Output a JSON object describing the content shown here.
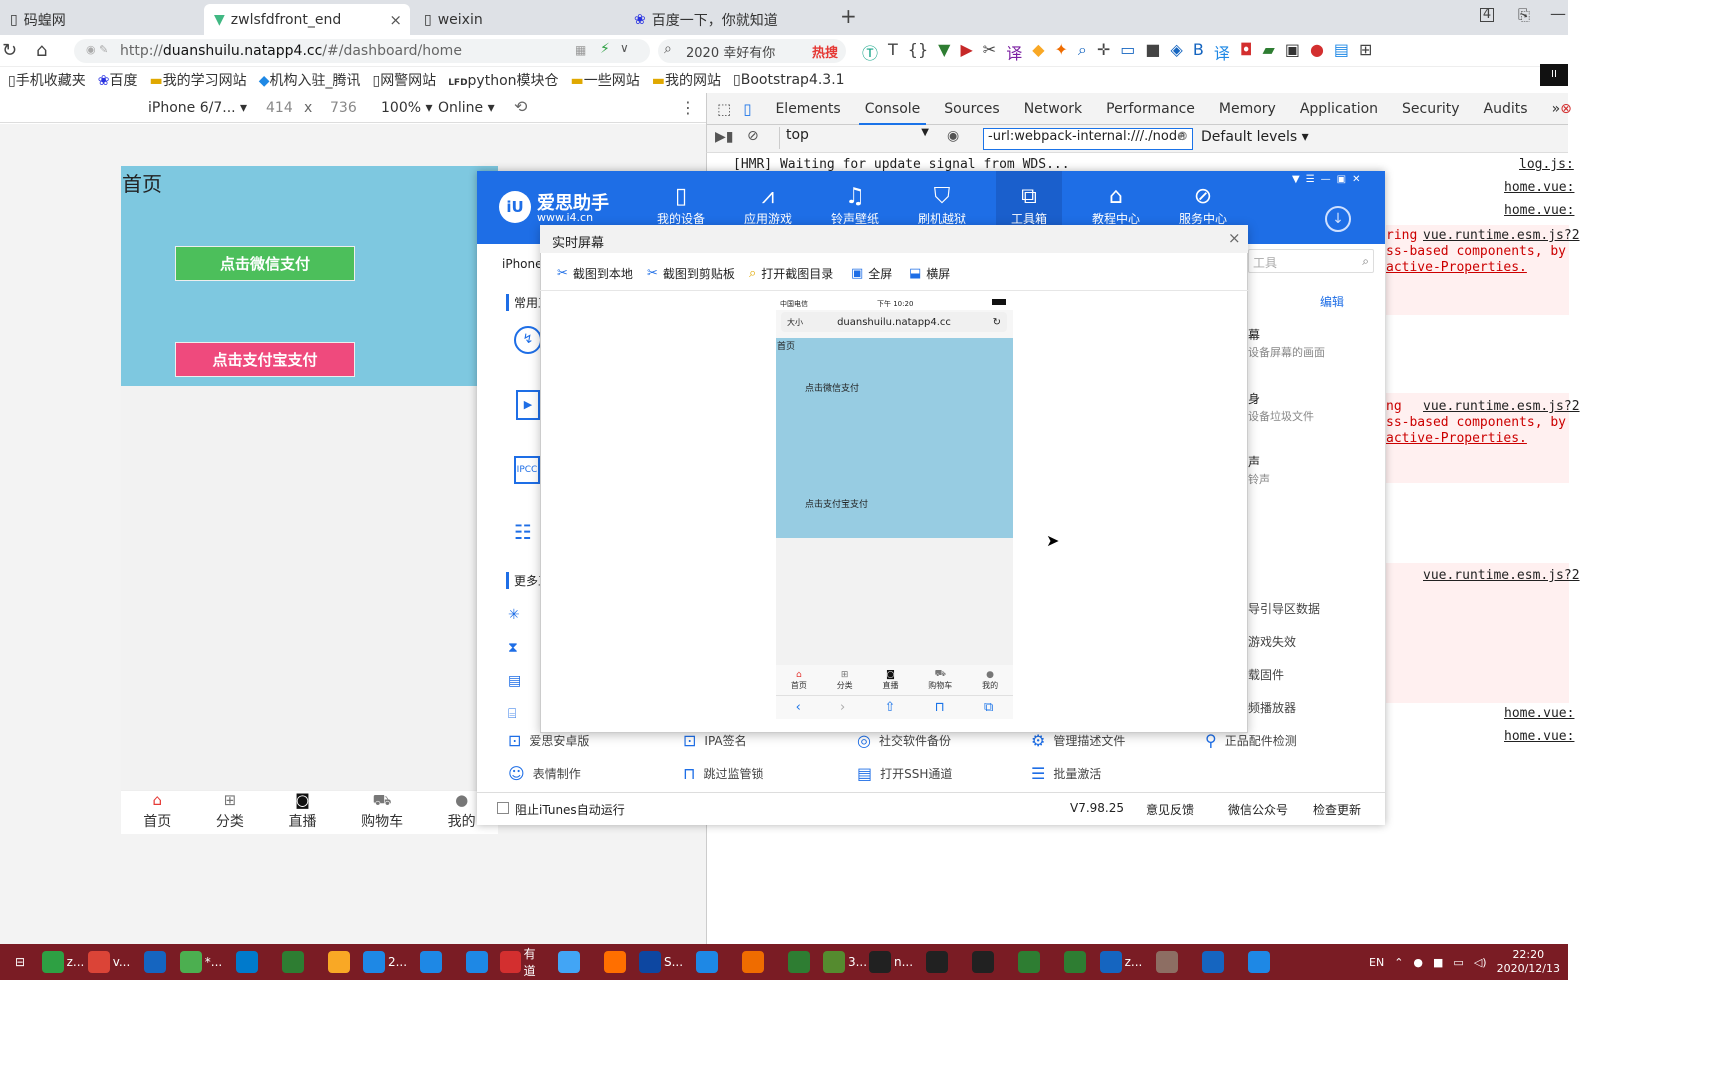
{
  "tabs": [
    {
      "label": "码蝗网"
    },
    {
      "label": "zwlsfdfront_end"
    },
    {
      "label": "weixin"
    },
    {
      "label": "百度一下，你就知道"
    }
  ],
  "addressbar": {
    "url_prefix": "http://",
    "url_domain": "duanshuilu.natapp4.cc",
    "url_path": "/#/dashboard/home",
    "search_text": "2020 幸好有你",
    "hot_label": "热搜"
  },
  "bookmarks": [
    "手机收藏夹",
    "百度",
    "我的学习网站",
    "机构入驻_腾讯",
    "网警网站",
    "python模块仓",
    "一些网站",
    "我的网站",
    "Bootstrap4.3.1"
  ],
  "device_toolbar": {
    "device": "iPhone 6/7...",
    "width": "414",
    "x": "x",
    "height": "736",
    "zoom": "100%",
    "network": "Online"
  },
  "phone": {
    "title": "首页",
    "wechat_pay": "点击微信支付",
    "alipay": "点击支付宝支付",
    "nav": [
      {
        "label": "首页",
        "icon": "home-icon"
      },
      {
        "label": "分类",
        "icon": "grid-icon"
      },
      {
        "label": "直播",
        "icon": "tv-icon"
      },
      {
        "label": "购物车",
        "icon": "cart-icon"
      },
      {
        "label": "我的",
        "icon": "user-icon"
      }
    ]
  },
  "devtools": {
    "tabs": [
      "Elements",
      "Console",
      "Sources",
      "Network",
      "Performance",
      "Memory",
      "Application",
      "Security",
      "Audits"
    ],
    "more": "»",
    "context": "top",
    "filter": "-url:webpack-internal:///./node",
    "levels": "Default levels"
  },
  "console": {
    "hmr": "[HMR] Waiting for update signal from WDS...",
    "links": [
      "log.js:",
      "home.vue:",
      "home.vue:",
      "vue.runtime.esm.js?2",
      "vue.runtime.esm.js?2",
      "vue.runtime.esm.js?2",
      "home.vue:",
      "home.vue:"
    ],
    "warn1": [
      "ring",
      "ss-based components, by",
      "active-Properties."
    ],
    "warn2": [
      "ng",
      "ss-based components, by",
      "active-Properties."
    ]
  },
  "i4": {
    "brand": "爱思助手",
    "site": "www.i4.cn",
    "nav": [
      "我的设备",
      "应用游戏",
      "铃声壁纸",
      "刷机越狱",
      "工具箱",
      "教程中心",
      "服务中心"
    ],
    "device": "iPhone",
    "section_common": "常用工",
    "section_more": "更多工",
    "right": {
      "edit": "编辑",
      "search_placeholder": "工具",
      "r1": "幕",
      "r1s": "设备屏幕的画面",
      "r2": "身",
      "r2s": "设备垃圾文件",
      "r3": "声",
      "r3s": "铃声",
      "r4": "导引导区数据",
      "r5": "游戏失效",
      "r6": "载固件",
      "r7": "频播放器"
    },
    "tools_row1": [
      "爱思安卓版",
      "IPA签名",
      "社交软件备份",
      "管理描述文件",
      "正品配件检测"
    ],
    "tools_row2": [
      "表情制作",
      "跳过监管锁",
      "打开SSH通道",
      "批量激活"
    ],
    "footer": {
      "itunes": "阻止iTunes自动运行",
      "version": "V7.98.25",
      "feedback": "意见反馈",
      "wechat": "微信公众号",
      "update": "检查更新"
    }
  },
  "live": {
    "title": "实时屏幕",
    "close": "×",
    "tools": [
      "截图到本地",
      "截图到剪贴板",
      "打开截图目录",
      "全屏",
      "横屏"
    ],
    "status_carrier": "中国电信",
    "status_time": "下午 10:20",
    "text_size": "大小",
    "url": "duanshuilu.natapp4.cc",
    "page_title": "首页",
    "wechat_pay": "点击微信支付",
    "alipay": "点击支付宝支付",
    "nav": [
      "首页",
      "分类",
      "直播",
      "购物车",
      "我的"
    ]
  },
  "taskbar": {
    "time": "22:20",
    "date": "2020/12/13",
    "lang": "EN",
    "apps": [
      {
        "label": "z...",
        "color": "#2ea043"
      },
      {
        "label": "v...",
        "color": "#db4437"
      },
      {
        "label": "",
        "color": "#1565c0"
      },
      {
        "label": "*...",
        "color": "#4caf50"
      },
      {
        "label": "",
        "color": "#007acc"
      },
      {
        "label": "",
        "color": "#2e7d32"
      },
      {
        "label": "",
        "color": "#f9a825"
      },
      {
        "label": "2...",
        "color": "#1e88e5"
      },
      {
        "label": "",
        "color": "#1e88e5"
      },
      {
        "label": "",
        "color": "#1e88e5"
      },
      {
        "label": "有道",
        "color": "#d32f2f"
      },
      {
        "label": "",
        "color": "#42a5f5"
      },
      {
        "label": "",
        "color": "#ff6f00"
      },
      {
        "label": "S...",
        "color": "#0d47a1"
      },
      {
        "label": "",
        "color": "#1e88e5"
      },
      {
        "label": "",
        "color": "#ef6c00"
      },
      {
        "label": "",
        "color": "#2e7d32"
      },
      {
        "label": "3...",
        "color": "#558b2f"
      },
      {
        "label": "n...",
        "color": "#212121"
      },
      {
        "label": "",
        "color": "#212121"
      },
      {
        "label": "",
        "color": "#212121"
      },
      {
        "label": "",
        "color": "#2e7d32"
      },
      {
        "label": "",
        "color": "#2e7d32"
      },
      {
        "label": "z...",
        "color": "#1565c0"
      },
      {
        "label": "",
        "color": "#8d6e63"
      },
      {
        "label": "",
        "color": "#1565c0"
      },
      {
        "label": "",
        "color": "#1e88e5"
      }
    ]
  }
}
